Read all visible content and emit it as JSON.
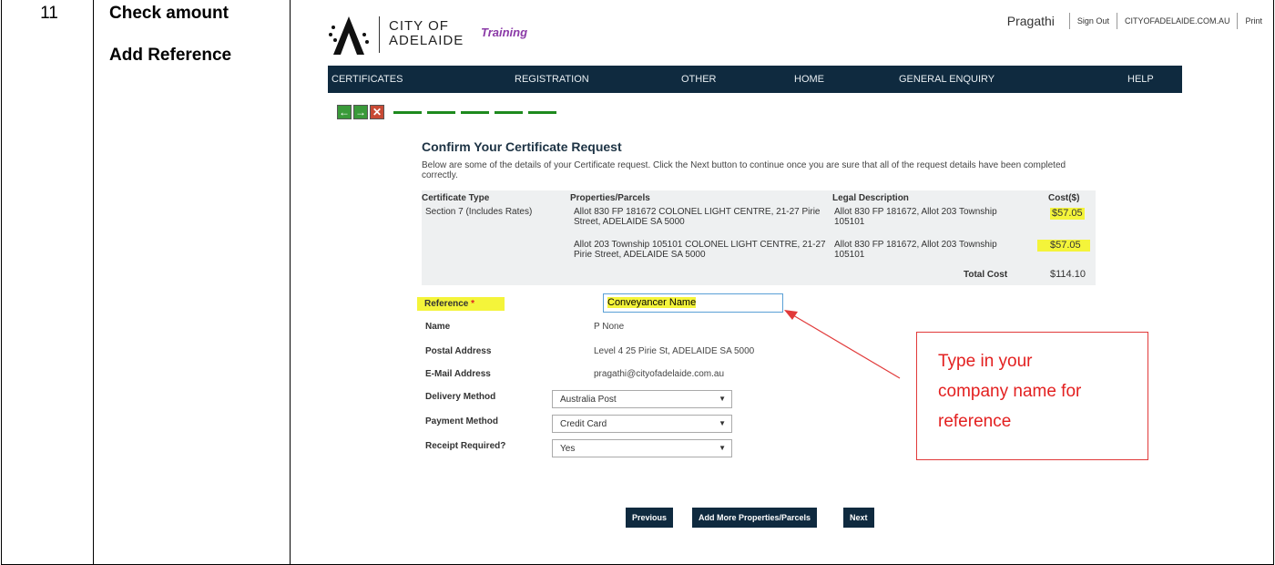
{
  "step": {
    "number": "11",
    "line1": "Check amount",
    "line2": "Add Reference"
  },
  "header": {
    "brand_line1": "CITY OF",
    "brand_line2": "ADELAIDE",
    "environment": "Training",
    "user_name": "Pragathi",
    "sign_out": "Sign Out",
    "site_link": "CITYOFADELAIDE.COM.AU",
    "print": "Print"
  },
  "nav": {
    "items": [
      "CERTIFICATES",
      "REGISTRATION",
      "OTHER",
      "HOME",
      "GENERAL ENQUIRY",
      "HELP"
    ]
  },
  "wizard": {
    "back_icon": "arrow-left-icon",
    "forward_icon": "arrow-right-icon",
    "cancel_icon": "close-icon",
    "back_glyph": "←",
    "forward_glyph": "→",
    "cancel_glyph": "✕"
  },
  "page": {
    "title": "Confirm Your Certificate Request",
    "intro": "Below are some of the details of your Certificate request. Click the Next button to continue once you are sure that all of the request details have been completed correctly."
  },
  "certificate_table": {
    "headers": {
      "type": "Certificate Type",
      "properties": "Properties/Parcels",
      "legal": "Legal Description",
      "cost": "Cost($)"
    },
    "rows": [
      {
        "type": "Section 7 (Includes Rates)",
        "property": "Allot 830 FP 181672 COLONEL LIGHT CENTRE, 21-27 Pirie Street, ADELAIDE SA 5000",
        "legal": "Allot 830 FP 181672, Allot 203 Township 105101",
        "cost": "$57.05"
      },
      {
        "type": "",
        "property": "Allot 203 Township 105101 COLONEL LIGHT CENTRE, 21-27 Pirie Street, ADELAIDE SA 5000",
        "legal": "Allot 830 FP 181672, Allot 203 Township 105101",
        "cost": "$57.05"
      }
    ],
    "total_label": "Total Cost",
    "total_value": "$114.10"
  },
  "form": {
    "reference_label": "Reference",
    "required_mark": "*",
    "reference_value": "Conveyancer Name",
    "name_label": "Name",
    "name_value": "P None",
    "postal_label": "Postal Address",
    "postal_value": "Level 4 25 Pirie St, ADELAIDE SA 5000",
    "email_label": "E-Mail Address",
    "email_value": "pragathi@cityofadelaide.com.au",
    "delivery_label": "Delivery Method",
    "delivery_value": "Australia Post",
    "payment_label": "Payment Method",
    "payment_value": "Credit Card",
    "receipt_label": "Receipt Required?",
    "receipt_value": "Yes"
  },
  "buttons": {
    "previous": "Previous",
    "add_more": "Add More Properties/Parcels",
    "next": "Next"
  },
  "callout": {
    "line1": "Type in your",
    "line2": "company name for",
    "line3": "reference"
  },
  "colors": {
    "navbar": "#0f2a3f",
    "highlight": "#f4f43a",
    "callout": "#e32020",
    "brand_purple": "#8b3aa7"
  }
}
